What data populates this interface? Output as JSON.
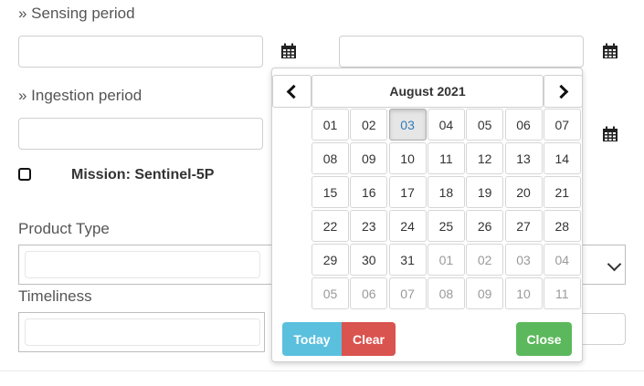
{
  "form": {
    "sensing_label": "» Sensing period",
    "ingestion_label": "» Ingestion period",
    "mission_label": "Mission: Sentinel-5P",
    "product_type_label": "Product Type",
    "timeliness_label": "Timeliness",
    "sensing_start_value": "",
    "sensing_end_value": "",
    "ingestion_start_value": ""
  },
  "icons": {
    "calendar": "calendar-icon",
    "checkbox": "checkbox-icon",
    "chevron": "chevron-down-icon"
  },
  "datepicker": {
    "title": "August 2021",
    "selected_day": "03",
    "weeks": [
      [
        {
          "d": "01",
          "m": false
        },
        {
          "d": "02",
          "m": false
        },
        {
          "d": "03",
          "m": false,
          "sel": true
        },
        {
          "d": "04",
          "m": false
        },
        {
          "d": "05",
          "m": false
        },
        {
          "d": "06",
          "m": false
        },
        {
          "d": "07",
          "m": false
        }
      ],
      [
        {
          "d": "08",
          "m": false
        },
        {
          "d": "09",
          "m": false
        },
        {
          "d": "10",
          "m": false
        },
        {
          "d": "11",
          "m": false
        },
        {
          "d": "12",
          "m": false
        },
        {
          "d": "13",
          "m": false
        },
        {
          "d": "14",
          "m": false
        }
      ],
      [
        {
          "d": "15",
          "m": false
        },
        {
          "d": "16",
          "m": false
        },
        {
          "d": "17",
          "m": false
        },
        {
          "d": "18",
          "m": false
        },
        {
          "d": "19",
          "m": false
        },
        {
          "d": "20",
          "m": false
        },
        {
          "d": "21",
          "m": false
        }
      ],
      [
        {
          "d": "22",
          "m": false
        },
        {
          "d": "23",
          "m": false
        },
        {
          "d": "24",
          "m": false
        },
        {
          "d": "25",
          "m": false
        },
        {
          "d": "26",
          "m": false
        },
        {
          "d": "27",
          "m": false
        },
        {
          "d": "28",
          "m": false
        }
      ],
      [
        {
          "d": "29",
          "m": false
        },
        {
          "d": "30",
          "m": false
        },
        {
          "d": "31",
          "m": false
        },
        {
          "d": "01",
          "m": true
        },
        {
          "d": "02",
          "m": true
        },
        {
          "d": "03",
          "m": true
        },
        {
          "d": "04",
          "m": true
        }
      ],
      [
        {
          "d": "05",
          "m": true
        },
        {
          "d": "06",
          "m": true
        },
        {
          "d": "07",
          "m": true
        },
        {
          "d": "08",
          "m": true
        },
        {
          "d": "09",
          "m": true
        },
        {
          "d": "10",
          "m": true
        },
        {
          "d": "11",
          "m": true
        }
      ]
    ],
    "today_label": "Today",
    "clear_label": "Clear",
    "close_label": "Close"
  },
  "colors": {
    "today_bg": "#5bc0de",
    "clear_bg": "#d9534f",
    "close_bg": "#5cb85c"
  }
}
